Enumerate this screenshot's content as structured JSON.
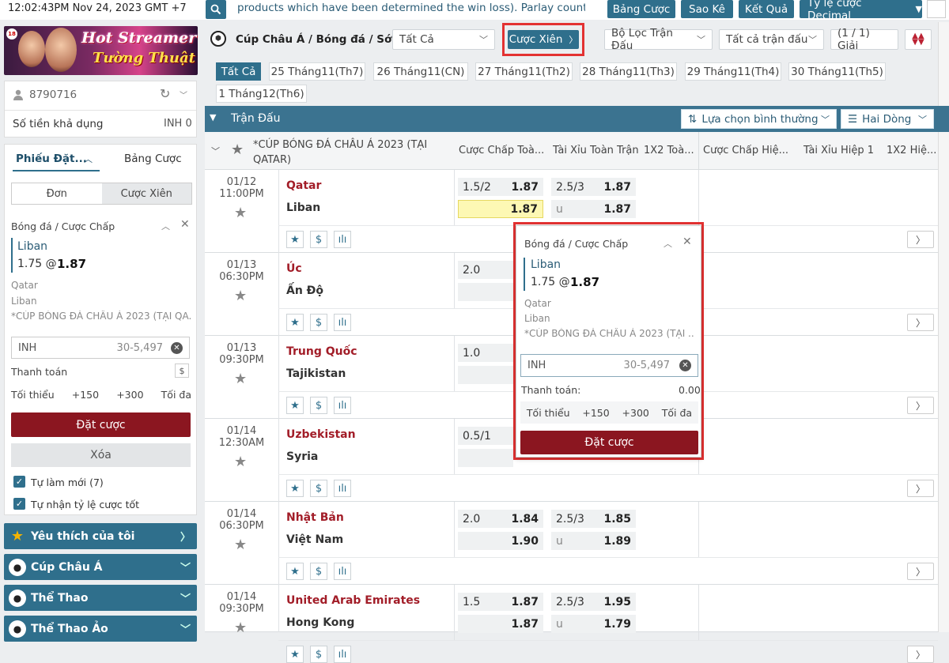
{
  "top": {
    "clock": "12:02:43PM Nov 24, 2023 GMT +7",
    "marquee": "products which have been determined the win loss). Parlay counted as",
    "buttons": [
      "Bảng Cược",
      "Sao Kê",
      "Kết Quả",
      "Tỷ lệ cược Decimal"
    ]
  },
  "banner": {
    "line1": "Hot Streamer",
    "line2": "Tường Thuật",
    "age_badge": "18"
  },
  "user": {
    "id": "8790716",
    "balance_label": "Số tiền khả dụng",
    "balance_value": "INH 0"
  },
  "betslip": {
    "tab_slip": "Phiếu Đặt...",
    "tab_board": "Bảng Cược",
    "seg_single": "Đơn",
    "seg_parlay": "Cược Xiên",
    "market": "Bóng đá / Cược Chấp",
    "selection": "Liban",
    "handicap": "1.75 @",
    "price": "1.87",
    "home": "Qatar",
    "away": "Liban",
    "league": "*CÚP BÓNG ĐÁ CHÂU Á 2023 (TẠI QA...",
    "currency": "INH",
    "range": "30-5,497",
    "payout_label": "Thanh toán",
    "payout_icon": "$",
    "quick": [
      "Tối thiểu",
      "+150",
      "+300",
      "Tối đa"
    ],
    "place": "Đặt cược",
    "clear": "Xóa",
    "auto_refresh": "Tự làm mới (7)",
    "auto_accept": "Tự nhận tỷ lệ cược tốt"
  },
  "nav": [
    {
      "label": "Yêu thích của tôi",
      "icon": "star-icon",
      "color": "#f5b400"
    },
    {
      "label": "Cúp Châu Á",
      "icon": "soccer-ball-icon",
      "color": "#ffffff"
    },
    {
      "label": "Thể Thao",
      "icon": "soccer-ball-icon",
      "color": "#ffffff"
    },
    {
      "label": "Thể Thao Ảo",
      "icon": "soccer-ball-icon",
      "color": "#ffffff"
    }
  ],
  "filters": {
    "title": "Cúp Châu Á / Bóng đá / Sớm",
    "all_select": "Tất Cả",
    "parlay_btn": "Cược Xiên",
    "match_filter": "Bộ Lọc Trận Đấu",
    "all_matches": "Tất cả trận đấu",
    "league_count": "(1 / 1) Giải"
  },
  "dates": [
    "Tất Cả",
    "25 Tháng11(Th7)",
    "26 Tháng11(CN)",
    "27 Tháng11(Th2)",
    "28 Tháng11(Th3)",
    "29 Tháng11(Th4)",
    "30 Tháng11(Th5)",
    "1 Tháng12(Th6)"
  ],
  "table": {
    "section": "Trận Đấu",
    "view_normal": "Lựa chọn bình thường",
    "view_lines": "Hai Dòng",
    "league": "*CÚP BÓNG ĐÁ CHÂU Á 2023 (TẠI QATAR)",
    "cols": [
      "Cược Chấp Toà...",
      "Tài Xỉu Toàn Trận",
      "1X2 Toà...",
      "Cược Chấp Hiệ...",
      "Tài Xỉu Hiệp 1",
      "1X2 Hiệ..."
    ]
  },
  "matches": [
    {
      "date": "01/12",
      "time": "11:00PM",
      "home": "Qatar",
      "away": "Liban",
      "hdp_line": "1.5/2",
      "hdp_home": "1.87",
      "hdp_away": "1.87",
      "ou_line": "2.5/3",
      "ou_over": "1.87",
      "ou_u": "u",
      "ou_under": "1.87"
    },
    {
      "date": "01/13",
      "time": "06:30PM",
      "home": "Úc",
      "away": "Ấn Độ",
      "hdp_line": "2.0",
      "hdp_home": "",
      "hdp_away": "",
      "ou_line": "",
      "ou_over": "",
      "ou_u": "",
      "ou_under": ""
    },
    {
      "date": "01/13",
      "time": "09:30PM",
      "home": "Trung Quốc",
      "away": "Tajikistan",
      "hdp_line": "1.0",
      "hdp_home": "",
      "hdp_away": "",
      "ou_line": "",
      "ou_over": "",
      "ou_u": "",
      "ou_under": ""
    },
    {
      "date": "01/14",
      "time": "12:30AM",
      "home": "Uzbekistan",
      "away": "Syria",
      "hdp_line": "0.5/1",
      "hdp_home": "",
      "hdp_away": "",
      "ou_line": "",
      "ou_over": "",
      "ou_u": "",
      "ou_under": ""
    },
    {
      "date": "01/14",
      "time": "06:30PM",
      "home": "Nhật Bản",
      "away": "Việt Nam",
      "hdp_line": "2.0",
      "hdp_home": "1.84",
      "hdp_away": "1.90",
      "ou_line": "2.5/3",
      "ou_over": "1.85",
      "ou_u": "u",
      "ou_under": "1.89"
    },
    {
      "date": "01/14",
      "time": "09:30PM",
      "home": "United Arab Emirates",
      "away": "Hong Kong",
      "hdp_line": "1.5",
      "hdp_home": "1.87",
      "hdp_away": "1.87",
      "ou_line": "2.5/3",
      "ou_over": "1.95",
      "ou_u": "u",
      "ou_under": "1.79"
    }
  ],
  "popup": {
    "market": "Bóng đá / Cược Chấp",
    "selection": "Liban",
    "handicap": "1.75 @",
    "price": "1.87",
    "home": "Qatar",
    "away": "Liban",
    "league": "*CÚP BÓNG ĐÁ CHÂU Á 2023 (TẠI ...",
    "currency": "INH",
    "range": "30-5,497",
    "payout_label": "Thanh toán:",
    "payout_value": "0.00",
    "quick": [
      "Tối thiểu",
      "+150",
      "+300",
      "Tối đa"
    ],
    "place": "Đặt cược"
  },
  "colors": {
    "primary": "#2f6f8c",
    "header": "#3b7390",
    "team_red": "#a21d28",
    "bet_red": "#8b1620",
    "highlight": "#e33232",
    "selected_odd": "#fdf8b4"
  }
}
